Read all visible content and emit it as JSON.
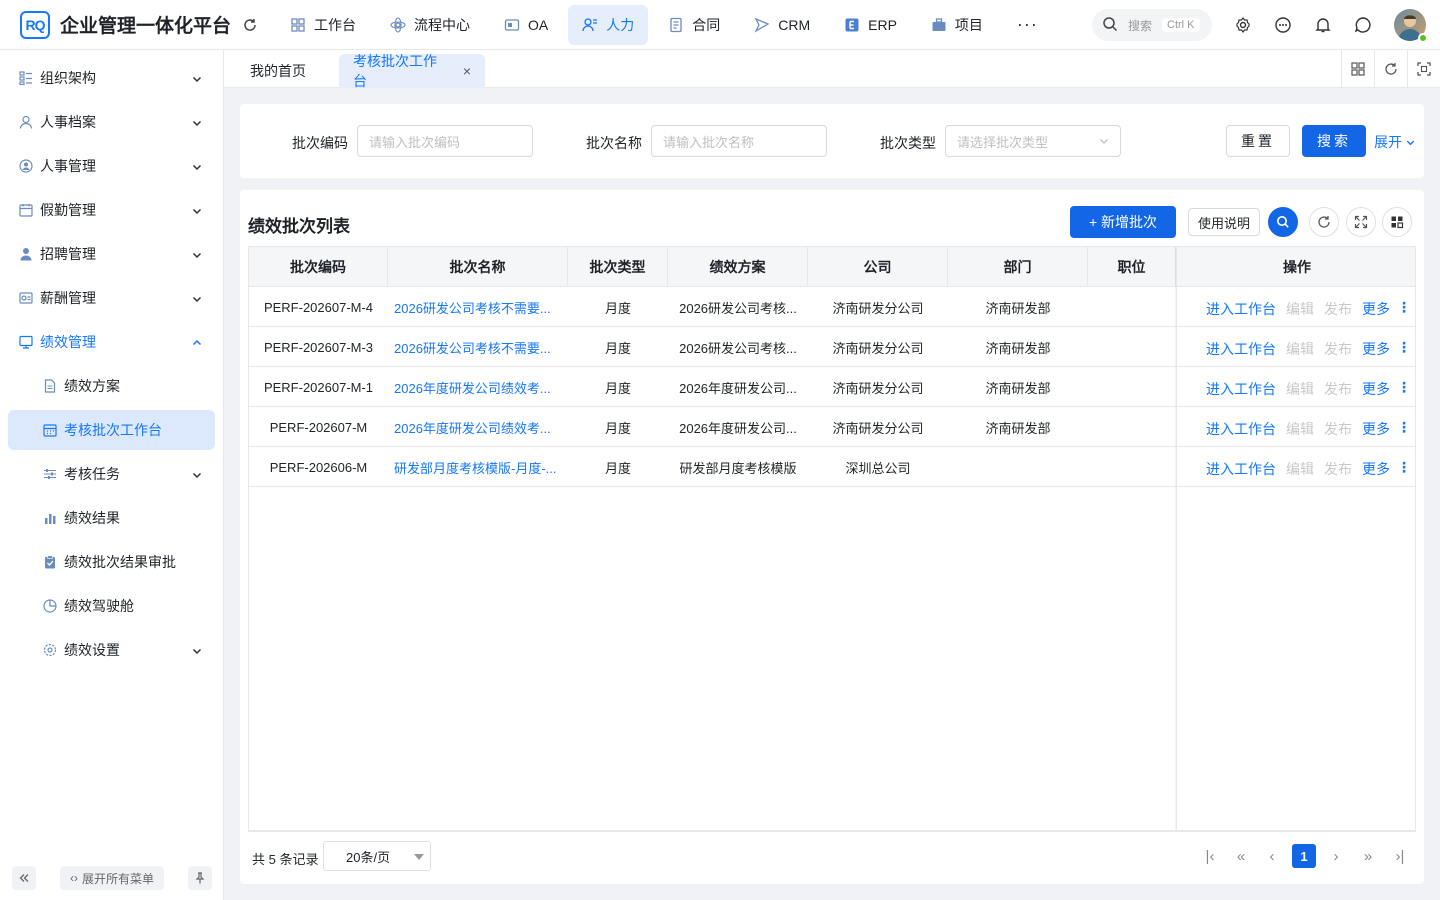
{
  "app": {
    "logo_text": "RQ",
    "title": "企业管理一体化平台"
  },
  "topnav": [
    {
      "label": "工作台",
      "icon": "grid-icon",
      "active": false
    },
    {
      "label": "流程中心",
      "icon": "process-icon",
      "active": false
    },
    {
      "label": "OA",
      "icon": "oa-icon",
      "active": false
    },
    {
      "label": "人力",
      "icon": "people-icon",
      "active": true
    },
    {
      "label": "合同",
      "icon": "contract-icon",
      "active": false
    },
    {
      "label": "CRM",
      "icon": "crm-icon",
      "active": false
    },
    {
      "label": "ERP",
      "icon": "erp-icon",
      "active": false
    },
    {
      "label": "项目",
      "icon": "project-icon",
      "active": false
    }
  ],
  "nav_more": "···",
  "search": {
    "placeholder": "搜索",
    "shortcut": "Ctrl K"
  },
  "sidebar": {
    "items": [
      {
        "label": "组织架构",
        "icon": "org-icon"
      },
      {
        "label": "人事档案",
        "icon": "person-icon"
      },
      {
        "label": "人事管理",
        "icon": "user-circle-icon"
      },
      {
        "label": "假勤管理",
        "icon": "calendar-icon"
      },
      {
        "label": "招聘管理",
        "icon": "recruit-icon"
      },
      {
        "label": "薪酬管理",
        "icon": "salary-icon"
      },
      {
        "label": "绩效管理",
        "icon": "performance-icon"
      }
    ],
    "sub_items": [
      {
        "label": "绩效方案",
        "icon": "document-icon"
      },
      {
        "label": "考核批次工作台",
        "icon": "calendar-grid-icon"
      },
      {
        "label": "考核任务",
        "icon": "sliders-icon"
      },
      {
        "label": "绩效结果",
        "icon": "bar-chart-icon"
      },
      {
        "label": "绩效批次结果审批",
        "icon": "clipboard-check-icon"
      },
      {
        "label": "绩效驾驶舱",
        "icon": "pie-icon"
      },
      {
        "label": "绩效设置",
        "icon": "gear-icon"
      }
    ],
    "expand_all": "展开所有菜单"
  },
  "tabs": [
    {
      "label": "我的首页",
      "active": false
    },
    {
      "label": "考核批次工作台",
      "active": true
    }
  ],
  "filters": {
    "batch_code_label": "批次编码",
    "batch_code_placeholder": "请输入批次编码",
    "batch_name_label": "批次名称",
    "batch_name_placeholder": "请输入批次名称",
    "batch_type_label": "批次类型",
    "batch_type_placeholder": "请选择批次类型",
    "reset": "重置",
    "search": "搜索",
    "expand": "展开"
  },
  "list": {
    "title": "绩效批次列表",
    "add_button": "+ 新增批次",
    "help_button": "使用说明"
  },
  "table": {
    "columns": [
      "批次编码",
      "批次名称",
      "批次类型",
      "绩效方案",
      "公司",
      "部门",
      "职位",
      "操作"
    ],
    "rows": [
      {
        "code": "PERF-202607-M-4",
        "name": "2026研发公司考核不需要...",
        "type": "月度",
        "plan": "2026研发公司考核...",
        "company": "济南研发分公司",
        "dept": "济南研发部",
        "position": ""
      },
      {
        "code": "PERF-202607-M-3",
        "name": "2026研发公司考核不需要...",
        "type": "月度",
        "plan": "2026研发公司考核...",
        "company": "济南研发分公司",
        "dept": "济南研发部",
        "position": ""
      },
      {
        "code": "PERF-202607-M-1",
        "name": "2026年度研发公司绩效考...",
        "type": "月度",
        "plan": "2026年度研发公司...",
        "company": "济南研发分公司",
        "dept": "济南研发部",
        "position": ""
      },
      {
        "code": "PERF-202607-M",
        "name": "2026年度研发公司绩效考...",
        "type": "月度",
        "plan": "2026年度研发公司...",
        "company": "济南研发分公司",
        "dept": "济南研发部",
        "position": ""
      },
      {
        "code": "PERF-202606-M",
        "name": "研发部月度考核模版-月度-...",
        "type": "月度",
        "plan": "研发部月度考核模版",
        "company": "深圳总公司",
        "dept": "",
        "position": ""
      }
    ],
    "actions": {
      "enter": "进入工作台",
      "edit": "编辑",
      "publish": "发布",
      "more": "更多"
    }
  },
  "pagination": {
    "total_text": "共 5 条记录",
    "page_size": "20条/页",
    "current_page": "1"
  },
  "colors": {
    "primary": "#1366e6",
    "link": "#1677ff",
    "disabled": "#c8c8c8"
  }
}
